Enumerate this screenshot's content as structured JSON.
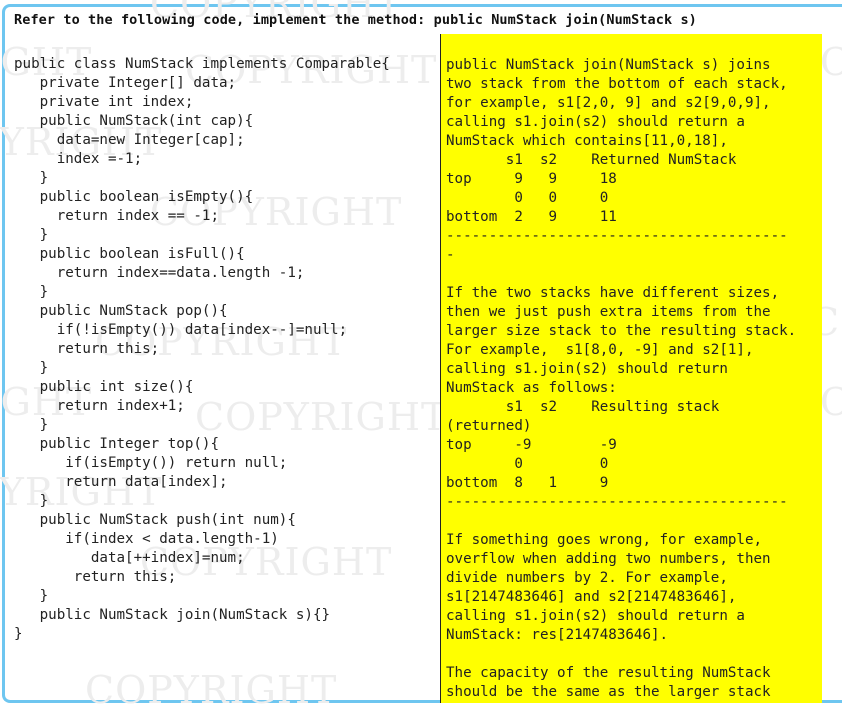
{
  "question": "Refer to the following code, implement the method: public NumStack join(NumStack s)",
  "watermark_text": "COPYRIGHT",
  "code_lines": [
    "public class NumStack implements Comparable{",
    "   private Integer[] data;",
    "   private int index;",
    "   public NumStack(int cap){",
    "     data=new Integer[cap];",
    "     index =-1;",
    "   }",
    "   public boolean isEmpty(){",
    "     return index == -1;",
    "   }",
    "   public boolean isFull(){",
    "     return index==data.length -1;",
    "   }",
    "   public NumStack pop(){",
    "     if(!isEmpty()) data[index--]=null;",
    "     return this;",
    "   }",
    "   public int size(){",
    "     return index+1;",
    "   }",
    "   public Integer top(){",
    "      if(isEmpty()) return null;",
    "      return data[index];",
    "   }",
    "   public NumStack push(int num){",
    "      if(index < data.length-1)",
    "         data[++index]=num;",
    "       return this;",
    "   }",
    "   public NumStack join(NumStack s){}",
    "}"
  ],
  "notes_lines": [
    "public NumStack join(NumStack s) joins",
    "two stack from the bottom of each stack,",
    "for example, s1[2,0, 9] and s2[9,0,9],",
    "calling s1.join(s2) should return a",
    "NumStack which contains[11,0,18],",
    "       s1  s2    Returned NumStack",
    "top     9   9     18",
    "        0   0     0",
    "bottom  2   9     11",
    "----------------------------------------",
    "-",
    "",
    "If the two stacks have different sizes,",
    "then we just push extra items from the",
    "larger size stack to the resulting stack.",
    "For example,  s1[8,0, -9] and s2[1],",
    "calling s1.join(s2) should return",
    "NumStack as follows:",
    "       s1  s2    Resulting stack",
    "(returned)",
    "top     -9        -9",
    "        0         0",
    "bottom  8   1     9",
    "----------------------------------------",
    "",
    "If something goes wrong, for example,",
    "overflow when adding two numbers, then",
    "divide numbers by 2. For example,",
    "s1[2147483646] and s2[2147483646],",
    "calling s1.join(s2) should return a",
    "NumStack: res[2147483646].",
    "",
    "The capacity of the resulting NumStack",
    "should be the same as the larger stack"
  ]
}
